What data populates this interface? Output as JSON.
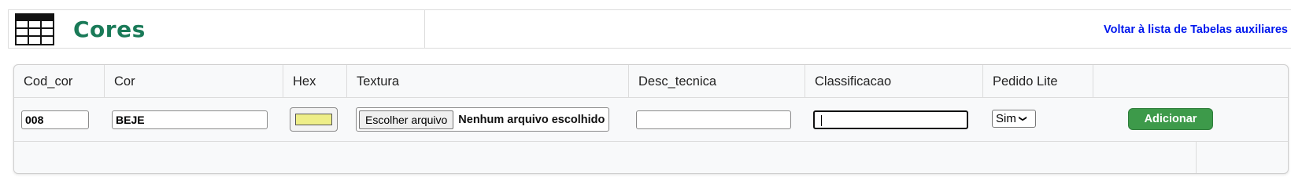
{
  "header": {
    "title": "Cores",
    "back_link": "Voltar à lista de Tabelas auxiliares",
    "icon": "table-grid-icon"
  },
  "table": {
    "columns": [
      "Cod_cor",
      "Cor",
      "Hex",
      "Textura",
      "Desc_tecnica",
      "Classificacao",
      "Pedido Lite",
      ""
    ],
    "form": {
      "cod_cor": "008",
      "cor": "BEJE",
      "hex_color": "#eeee88",
      "file_button": "Escolher arquivo",
      "file_status": "Nenhum arquivo escolhido",
      "desc_tecnica": "",
      "classificacao": "",
      "pedido_lite_selected": "Sim",
      "add_button": "Adicionar"
    }
  },
  "colors": {
    "title_green": "#1a7a58",
    "link_blue": "#0018ee",
    "button_green": "#3d9a4a"
  }
}
